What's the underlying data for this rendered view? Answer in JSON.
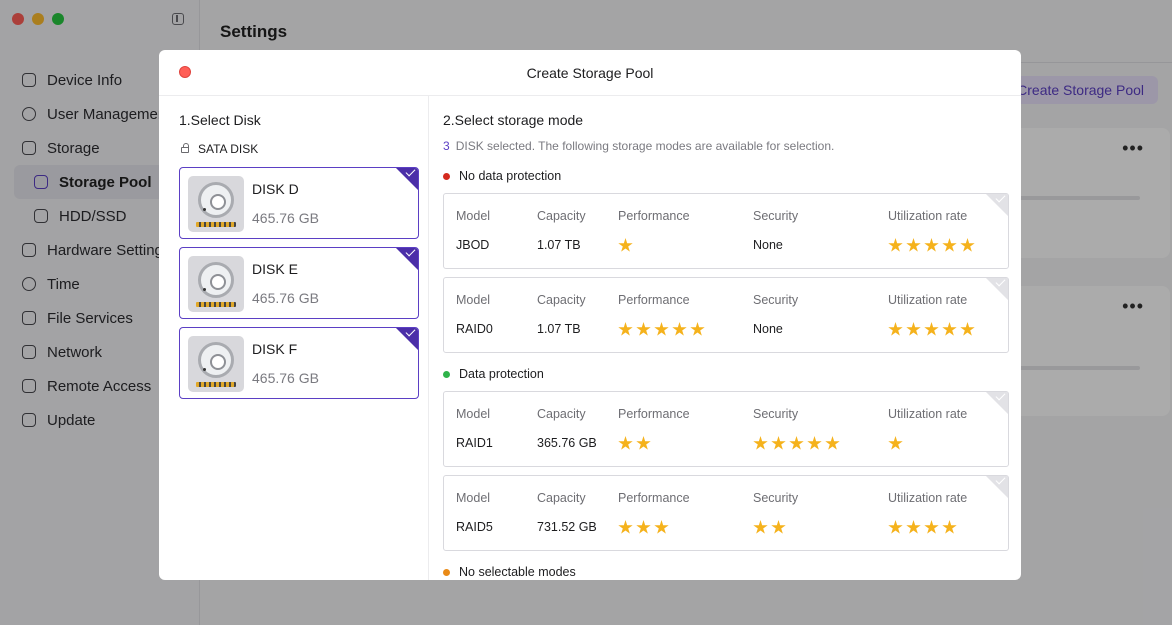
{
  "app": {
    "title": "Settings",
    "create_pool_label": "Create Storage Pool",
    "more_label": "•••"
  },
  "sidebar": {
    "items": [
      {
        "label": "Device Info",
        "name": "sidebar-item-device-info",
        "active": false,
        "sub": false
      },
      {
        "label": "User Management",
        "name": "sidebar-item-user-management",
        "active": false,
        "sub": false
      },
      {
        "label": "Storage",
        "name": "sidebar-item-storage",
        "active": false,
        "sub": false
      },
      {
        "label": "Storage Pool",
        "name": "sidebar-item-storage-pool",
        "active": true,
        "sub": true
      },
      {
        "label": "HDD/SSD",
        "name": "sidebar-item-hdd-ssd",
        "active": false,
        "sub": true
      },
      {
        "label": "Hardware Settings",
        "name": "sidebar-item-hardware-settings",
        "active": false,
        "sub": false
      },
      {
        "label": "Time",
        "name": "sidebar-item-time",
        "active": false,
        "sub": false
      },
      {
        "label": "File Services",
        "name": "sidebar-item-file-services",
        "active": false,
        "sub": false
      },
      {
        "label": "Network",
        "name": "sidebar-item-network",
        "active": false,
        "sub": false
      },
      {
        "label": "Remote Access",
        "name": "sidebar-item-remote-access",
        "active": false,
        "sub": false
      },
      {
        "label": "Update",
        "name": "sidebar-item-update",
        "active": false,
        "sub": false
      }
    ]
  },
  "modal": {
    "title": "Create Storage Pool",
    "select_disk_title": "1.Select Disk",
    "disk_group_label": "SATA DISK",
    "disks": [
      {
        "name": "DISK D",
        "size": "465.76 GB",
        "selected": true
      },
      {
        "name": "DISK E",
        "size": "465.76 GB",
        "selected": true
      },
      {
        "name": "DISK F",
        "size": "465.76 GB",
        "selected": true
      }
    ],
    "select_mode_title": "2.Select storage mode",
    "selected_count": "3",
    "selected_text": "DISK selected. The following storage modes are available for selection.",
    "column_headers": {
      "model": "Model",
      "capacity": "Capacity",
      "performance": "Performance",
      "security": "Security",
      "utilization": "Utilization rate"
    },
    "groups": {
      "no_protection": "No data protection",
      "protection": "Data protection",
      "none_selectable": "No selectable modes"
    },
    "modes": [
      {
        "model": "JBOD",
        "capacity": "1.07 TB",
        "performance": 1,
        "security_text": "None",
        "security": 0,
        "utilization": 5
      },
      {
        "model": "RAID0",
        "capacity": "1.07 TB",
        "performance": 5,
        "security_text": "None",
        "security": 0,
        "utilization": 5
      },
      {
        "model": "RAID1",
        "capacity": "365.76 GB",
        "performance": 2,
        "security": 5,
        "utilization": 1
      },
      {
        "model": "RAID5",
        "capacity": "731.52 GB",
        "performance": 3,
        "security": 2,
        "utilization": 4
      }
    ]
  },
  "colors": {
    "accent": "#5b3fc4",
    "star": "#f5b21c",
    "no_protection_dot": "#d42a1e",
    "protection_dot": "#2fb34a",
    "none_dot": "#e98a17"
  }
}
